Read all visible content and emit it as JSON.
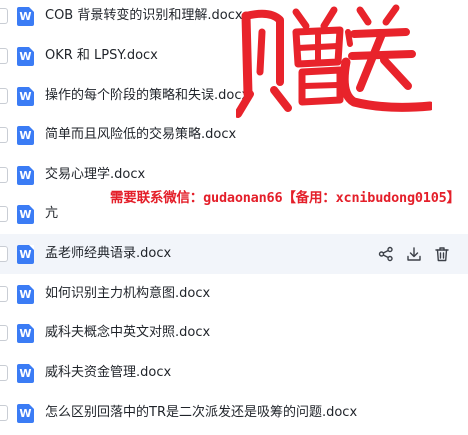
{
  "files": [
    {
      "name": "COB 背景转变的识别和理解.docx",
      "icon": "word-doc-icon",
      "icon_letter": "W"
    },
    {
      "name": "OKR 和 LPSY.docx",
      "icon": "word-doc-icon",
      "icon_letter": "W"
    },
    {
      "name": "操作的每个阶段的策略和失误.docx",
      "icon": "word-doc-icon",
      "icon_letter": "W"
    },
    {
      "name": "简单而且风险低的交易策略.docx",
      "icon": "word-doc-icon",
      "icon_letter": "W"
    },
    {
      "name": "交易心理学.docx",
      "icon": "word-doc-icon",
      "icon_letter": "W"
    },
    {
      "name": "亢",
      "icon": "word-doc-icon",
      "icon_letter": "W"
    },
    {
      "name": "孟老师经典语录.docx",
      "icon": "word-doc-icon",
      "icon_letter": "W",
      "hovered": true
    },
    {
      "name": "如何识别主力机构意图.docx",
      "icon": "word-doc-icon",
      "icon_letter": "W"
    },
    {
      "name": "威科夫概念中英文对照.docx",
      "icon": "word-doc-icon",
      "icon_letter": "W"
    },
    {
      "name": "威科夫资金管理.docx",
      "icon": "word-doc-icon",
      "icon_letter": "W"
    },
    {
      "name": "怎么区别回落中的TR是二次派发还是吸筹的问题.docx",
      "icon": "word-doc-icon",
      "icon_letter": "W"
    }
  ],
  "row_actions": [
    {
      "name": "share",
      "icon": "share-icon"
    },
    {
      "name": "download",
      "icon": "download-icon"
    },
    {
      "name": "delete",
      "icon": "trash-icon"
    }
  ],
  "overlay": {
    "prefix": "需要联系微信：",
    "wechat": "gudaonan66",
    "backup_open": "【备用：",
    "backup_id": "xcnibudong0105",
    "backup_close": "】",
    "color": "#e41f2a"
  },
  "watermark": {
    "text": "赠送",
    "color": "#e8232b"
  },
  "colors": {
    "word_icon": "#3b7cf5",
    "hover_row": "#f2f5fa",
    "text": "#1f2329",
    "action_icon": "#3c4048"
  }
}
